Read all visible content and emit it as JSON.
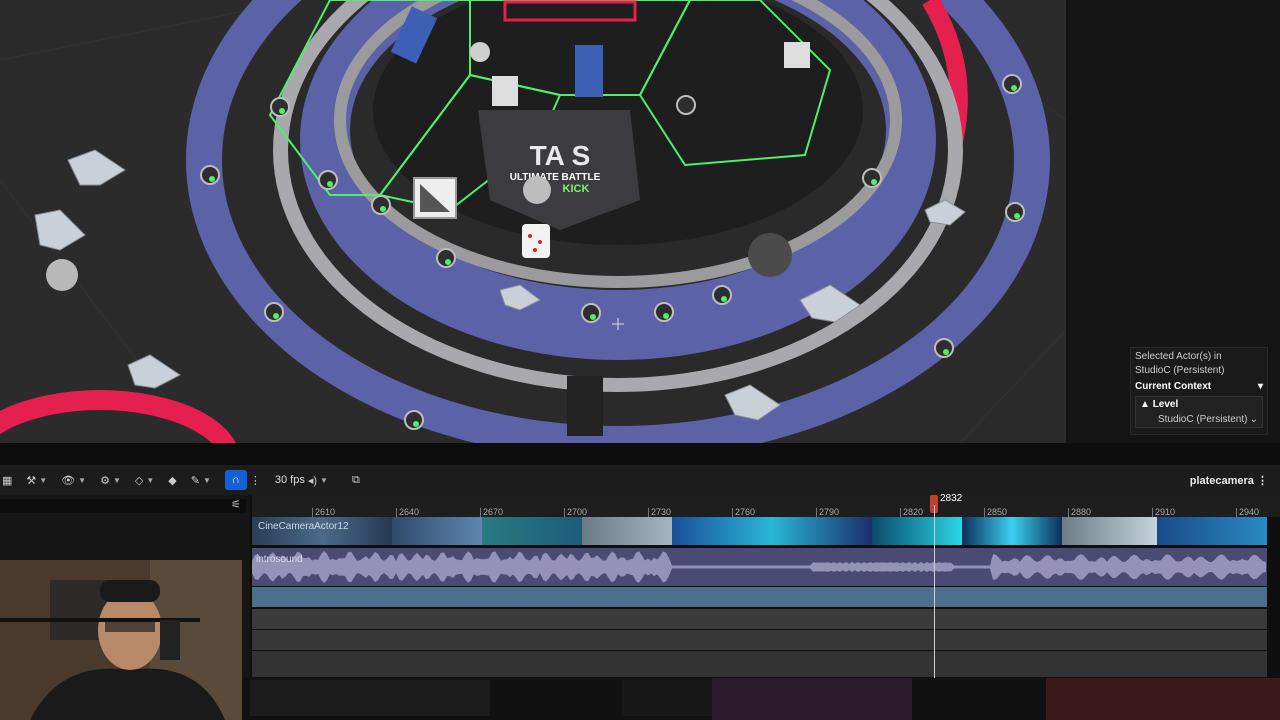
{
  "viewport": {
    "logo_text_1": "TA  S",
    "logo_text_2": "ULTIMATE BATTLE",
    "logo_text_3": "KICK"
  },
  "context": {
    "selected_line1": "Selected Actor(s) in",
    "selected_line2": "StudioC (Persistent)",
    "header": "Current Context",
    "level_label": "Level",
    "level_value": "StudioC (Persistent)"
  },
  "toolbar": {
    "fps": "30 fps",
    "camera_name": "platecamera"
  },
  "timeline": {
    "ticks": [
      "2610",
      "2640",
      "2670",
      "2700",
      "2730",
      "2760",
      "2790",
      "2820",
      "2850",
      "2880",
      "2910",
      "2940"
    ],
    "playhead_frame": "2832"
  },
  "tracks": {
    "camera_label": "CineCameraActor12",
    "audio_label": "introsound"
  },
  "colors": {
    "accent_snap": "#1560d4",
    "ring_blue": "#5b62a8",
    "hex_outline": "#4cf06a",
    "ring_red": "#e5204f",
    "playhead": "#c04030"
  }
}
